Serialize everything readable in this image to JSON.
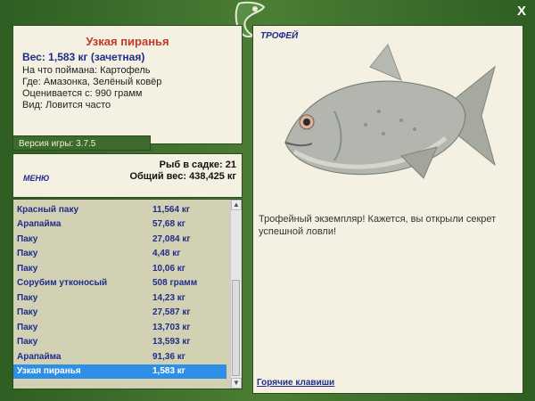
{
  "fish_title": "Узкая пиранья",
  "weight_text": "Вес: 1,583 кг (зачетная)",
  "info_lines": [
    "На что поймана: Картофель",
    "Где: Амазонка, Зелёный ковёр",
    "Оценивается с: 990 грамм",
    "Вид: Ловится часто"
  ],
  "version": "Версия игры: 3.7.5",
  "menu_label": "МЕНЮ",
  "stats": {
    "count": "Рыб в садке: 21",
    "total": "Общий вес: 438,425 кг"
  },
  "list": [
    {
      "name": "Красный паку",
      "val": "11,564 кг"
    },
    {
      "name": "Арапайма",
      "val": "57,68 кг"
    },
    {
      "name": "Паку",
      "val": "27,084 кг"
    },
    {
      "name": "Паку",
      "val": "4,48 кг"
    },
    {
      "name": "Паку",
      "val": "10,06 кг"
    },
    {
      "name": "Сорубим утконосый",
      "val": "508 грамм"
    },
    {
      "name": "Паку",
      "val": "14,23 кг"
    },
    {
      "name": "Паку",
      "val": "27,587 кг"
    },
    {
      "name": "Паку",
      "val": "13,703 кг"
    },
    {
      "name": "Паку",
      "val": "13,593 кг"
    },
    {
      "name": "Арапайма",
      "val": "91,36 кг"
    },
    {
      "name": "Узкая пиранья",
      "val": "1,583 кг"
    }
  ],
  "trophy_label": "ТРОФЕЙ",
  "trophy_text": "Трофейный экземпляр! Кажется, вы открыли секрет успешной ловли!",
  "hotkeys": "Горячие клавиши",
  "close_symbol": "X",
  "colors": {
    "background": "#3d6b2e",
    "panel": "#f4f1e2",
    "list_bg": "#d2d1b4",
    "accent_blue": "#1f2c8a",
    "title_red": "#c0392b",
    "selected": "#2e8fe6"
  },
  "icons": [
    "close-icon",
    "logo-icon",
    "fish-image"
  ]
}
